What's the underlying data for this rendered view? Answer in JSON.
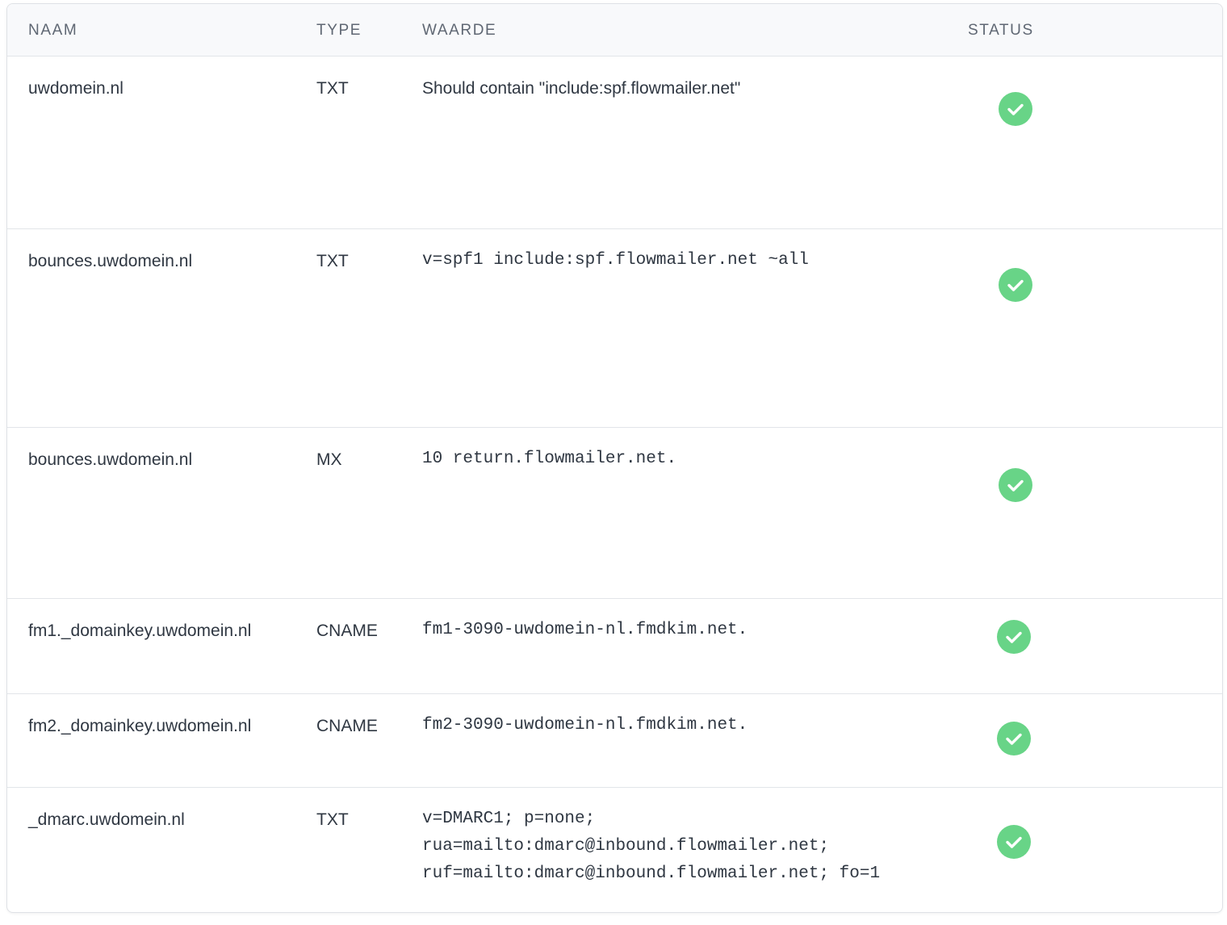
{
  "table": {
    "headers": {
      "name": "NAAM",
      "type": "TYPE",
      "value": "WAARDE",
      "status": "STATUS"
    },
    "rows": [
      {
        "name": "uwdomein.nl",
        "type": "TXT",
        "value": "Should contain \"include:spf.flowmailer.net\"",
        "status": "verified"
      },
      {
        "name": "bounces.uwdomein.nl",
        "type": "TXT",
        "value": "v=spf1 include:spf.flowmailer.net ~all",
        "status": "verified"
      },
      {
        "name": "bounces.uwdomein.nl",
        "type": "MX",
        "value": "10 return.flowmailer.net.",
        "status": "verified"
      },
      {
        "name": "fm1._domainkey.uwdomein.nl",
        "type": "CNAME",
        "value": "fm1-3090-uwdomein-nl.fmdkim.net.",
        "status": "verified"
      },
      {
        "name": "fm2._domainkey.uwdomein.nl",
        "type": "CNAME",
        "value": "fm2-3090-uwdomein-nl.fmdkim.net.",
        "status": "verified"
      },
      {
        "name": "_dmarc.uwdomein.nl",
        "type": "TXT",
        "value": "v=DMARC1; p=none;\nrua=mailto:dmarc@inbound.flowmailer.net;\nruf=mailto:dmarc@inbound.flowmailer.net; fo=1",
        "status": "verified"
      }
    ]
  },
  "icons": {
    "status": "check-circle-icon"
  },
  "colors": {
    "status_ok": "#68d487",
    "header_bg": "#f8f9fb",
    "text": "#2f3742"
  }
}
